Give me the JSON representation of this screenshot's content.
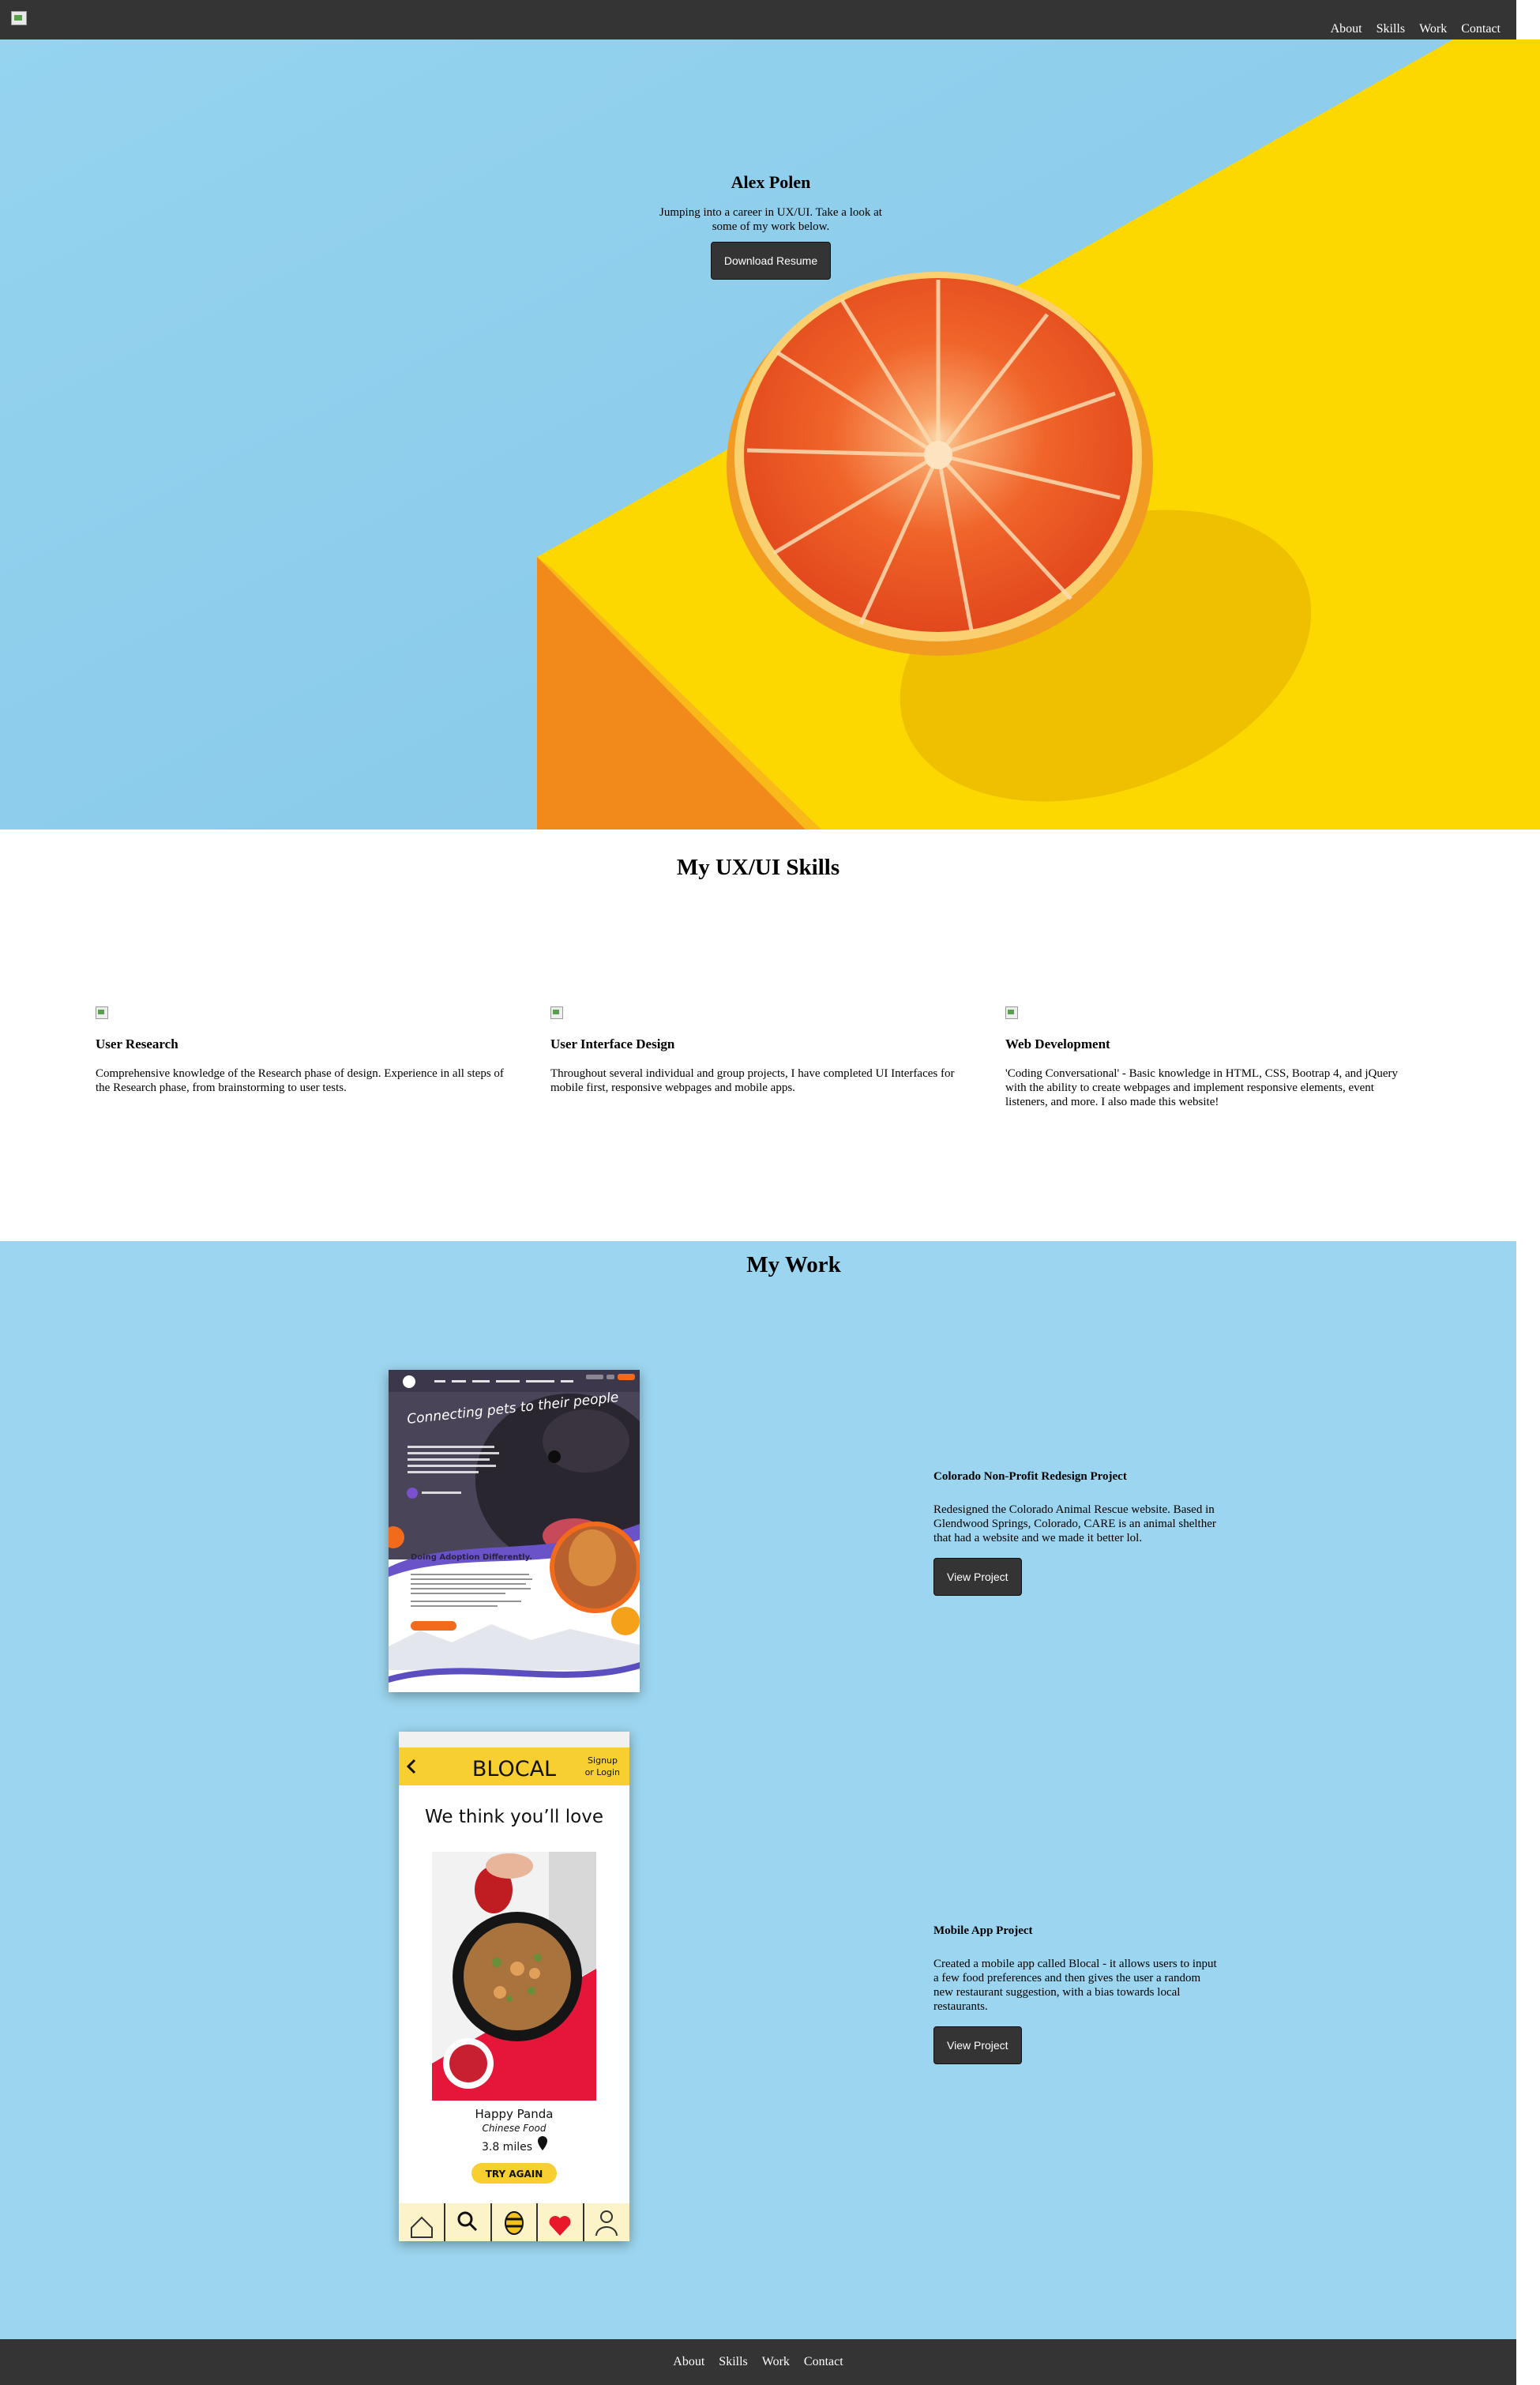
{
  "nav": {
    "links": [
      "About",
      "Skills",
      "Work",
      "Contact"
    ]
  },
  "hero": {
    "title": "Alex Polen",
    "subtitle": "Jumping into a career in UX/UI. Take a look at some of my work below.",
    "button": "Download Resume"
  },
  "skills": {
    "title": "My UX/UI Skills",
    "items": [
      {
        "title": "User Research",
        "text": "Comprehensive knowledge of the Research phase of design. Experience in all steps of the Research phase, from brainstorming to user tests."
      },
      {
        "title": "User Interface Design",
        "text": "Throughout several individual and group projects, I have completed UI Interfaces for mobile first, responsive webpages and mobile apps."
      },
      {
        "title": "Web Development",
        "text": "'Coding Conversational' - Basic knowledge in HTML, CSS, Bootrap 4, and jQuery with the ability to create webpages and implement responsive elements, event listeners, and more. I also made this website!"
      }
    ]
  },
  "work": {
    "title": "My Work",
    "projects": [
      {
        "title": "Colorado Non-Profit Redesign Project",
        "desc": "Redesigned the Colorado Animal Rescue website. Based in Glendwood Springs, Colorado, CARE is an animal shelther that had a website and we made it better lol.",
        "button": "View Project",
        "mock": {
          "headline": "Connecting pets to their people",
          "section": "Doing Adoption Differently."
        }
      },
      {
        "title": "Mobile App Project",
        "desc": "Created a mobile app called Blocal - it allows users to input a few food preferences and then gives the user a random new restaurant suggestion, with a bias towards local restaurants.",
        "button": "View Project",
        "mock": {
          "app_name": "BLOCAL",
          "signup": "Signup",
          "login": "or Login",
          "headline": "We think you’ll love",
          "restaurant": "Happy Panda",
          "cuisine": "Chinese Food",
          "distance": "3.8 miles",
          "try_again": "TRY AGAIN"
        }
      }
    ]
  },
  "footer": {
    "links": [
      "About",
      "Skills",
      "Work",
      "Contact"
    ]
  },
  "colors": {
    "dark": "#343434",
    "sky": "#8fcfec",
    "yellow": "#fdd800",
    "orange": "#f18a1a",
    "work_bg": "#9cd5ef"
  }
}
